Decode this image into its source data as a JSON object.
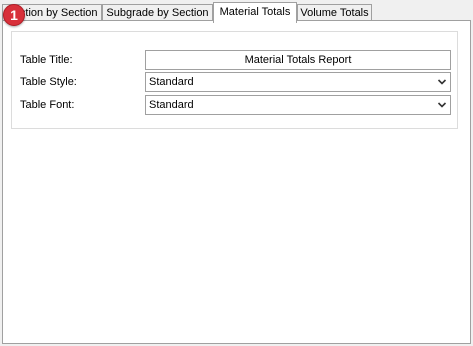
{
  "tabs": [
    {
      "label": "Section by Section",
      "active": false
    },
    {
      "label": "Subgrade by Section",
      "active": false
    },
    {
      "label": "Material Totals",
      "active": true
    },
    {
      "label": "Volume Totals",
      "active": false
    }
  ],
  "badge": {
    "number": "1",
    "color": "#d8303a"
  },
  "form": {
    "table_title_label": "Table Title:",
    "table_title_value": "Material Totals Report",
    "table_style_label": "Table Style:",
    "table_style_value": "Standard",
    "table_font_label": "Table Font:",
    "table_font_value": "Standard"
  },
  "icons": {
    "dropdown": "chevron-down-icon"
  }
}
